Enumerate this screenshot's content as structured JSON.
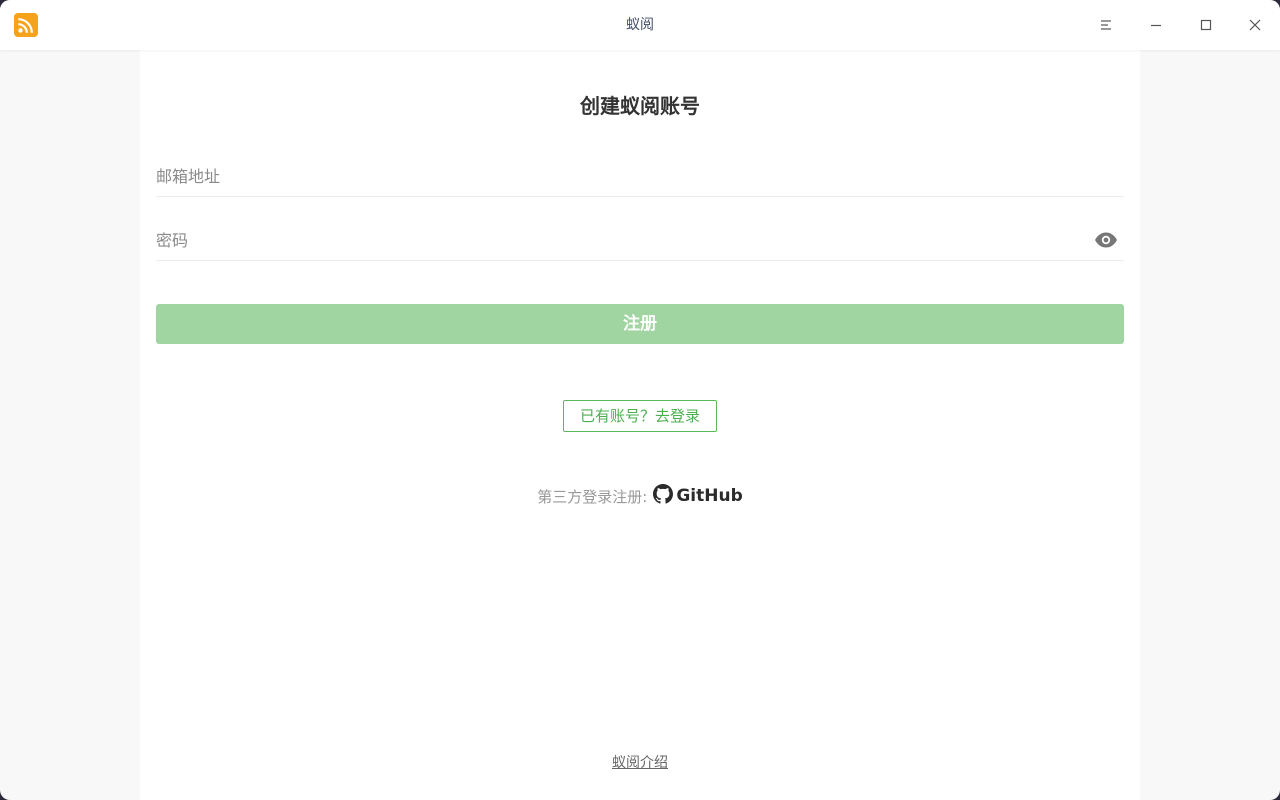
{
  "window": {
    "title": "蚁阅",
    "app_icon": "rss-icon",
    "controls": [
      "menu-icon",
      "minimize-icon",
      "maximize-icon",
      "close-icon"
    ]
  },
  "form": {
    "heading": "创建蚁阅账号",
    "email": {
      "value": "",
      "placeholder": "邮箱地址"
    },
    "password": {
      "value": "",
      "placeholder": "密码",
      "toggle_icon": "eye-icon"
    },
    "register_label": "注册",
    "login_link_label": "已有账号？去登录",
    "third_party_label": "第三方登录注册:",
    "github_label": "GitHub"
  },
  "footer": {
    "intro_label": "蚁阅介绍"
  },
  "colors": {
    "accent": "#4caf50",
    "button_bg": "#a0d5a1",
    "app_icon_bg": "#f7a21b"
  }
}
